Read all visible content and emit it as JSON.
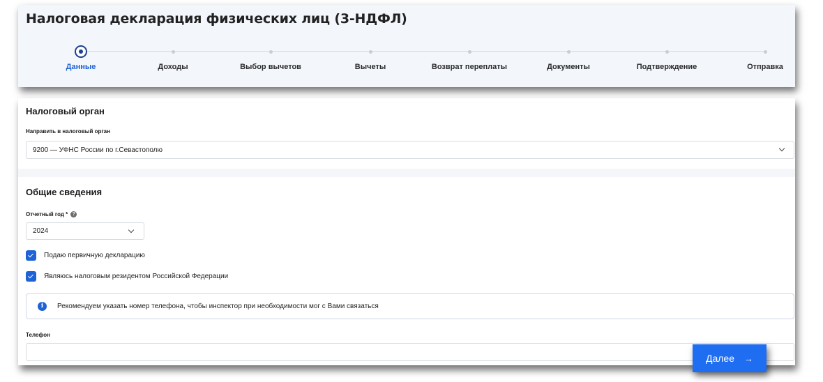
{
  "header": {
    "title": "Налоговая декларация физических лиц (3-НДФЛ)"
  },
  "stepper": {
    "steps": [
      {
        "label": "Данные",
        "active": true
      },
      {
        "label": "Доходы",
        "active": false
      },
      {
        "label": "Выбор вычетов",
        "active": false
      },
      {
        "label": "Вычеты",
        "active": false
      },
      {
        "label": "Возврат переплаты",
        "active": false
      },
      {
        "label": "Документы",
        "active": false
      },
      {
        "label": "Подтверждение",
        "active": false
      },
      {
        "label": "Отправка",
        "active": false
      }
    ]
  },
  "tax_authority": {
    "section_title": "Налоговый орган",
    "field_label": "Направить в налоговый орган",
    "selected_value": "9200 — УФНС России по г.Севастополю"
  },
  "general": {
    "section_title": "Общие сведения",
    "year_label": "Отчетный год *",
    "year_value": "2024",
    "checkbox_primary": {
      "label": "Подаю первичную декларацию",
      "checked": true
    },
    "checkbox_resident": {
      "label": "Являюсь налоговым резидентом Российской Федерации",
      "checked": true
    },
    "info_text": "Рекомендуем указать номер телефона, чтобы инспектор при необходимости мог с Вами связаться",
    "phone_label": "Телефон",
    "phone_value": ""
  },
  "actions": {
    "next_label": "Далее",
    "next_arrow": "→"
  },
  "colors": {
    "accent": "#1e62d6",
    "button": "#1f6df0",
    "header_bg": "#f3f6fb"
  }
}
